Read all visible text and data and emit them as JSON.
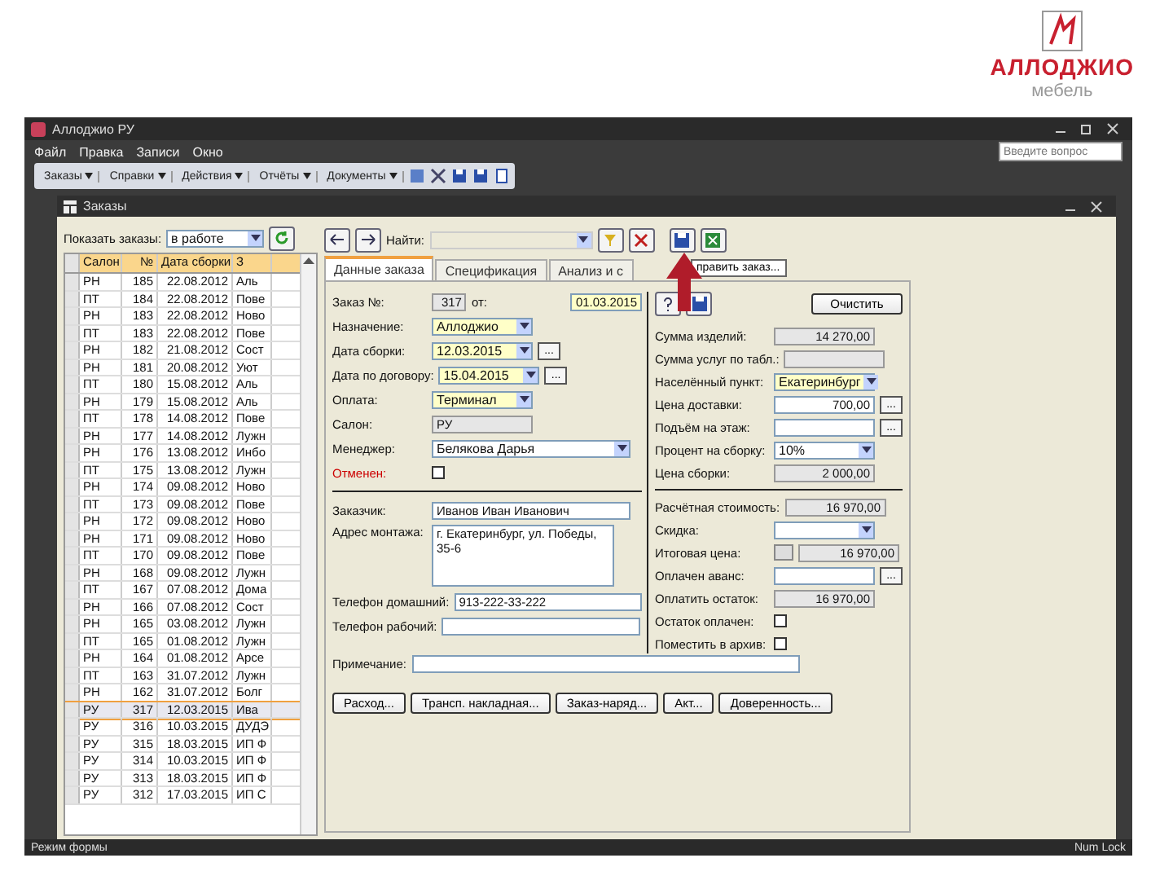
{
  "logo": {
    "brand": "АЛЛОДЖИО",
    "tagline": "мебель"
  },
  "window": {
    "title": "Аллоджио РУ"
  },
  "menu": [
    "Файл",
    "Правка",
    "Записи",
    "Окно"
  ],
  "help_box": {
    "placeholder": "Введите вопрос"
  },
  "toolbar": [
    "Заказы",
    "Справки",
    "Действия",
    "Отчёты",
    "Документы"
  ],
  "form": {
    "title": "Заказы"
  },
  "filter": {
    "label": "Показать заказы:",
    "value": "в работе"
  },
  "table": {
    "columns": [
      "Салон",
      "№",
      "Дата сборки",
      "З"
    ],
    "rows": [
      {
        "cells": [
          "РН",
          "185",
          "22.08.2012",
          "Аль"
        ],
        "selected": false
      },
      {
        "cells": [
          "ПТ",
          "184",
          "22.08.2012",
          "Пове"
        ],
        "selected": false
      },
      {
        "cells": [
          "РН",
          "183",
          "22.08.2012",
          "Ново"
        ],
        "selected": false
      },
      {
        "cells": [
          "ПТ",
          "183",
          "22.08.2012",
          "Пове"
        ],
        "selected": false
      },
      {
        "cells": [
          "РН",
          "182",
          "21.08.2012",
          "Сост"
        ],
        "selected": false
      },
      {
        "cells": [
          "РН",
          "181",
          "20.08.2012",
          "Уют"
        ],
        "selected": false
      },
      {
        "cells": [
          "ПТ",
          "180",
          "15.08.2012",
          "Аль"
        ],
        "selected": false
      },
      {
        "cells": [
          "РН",
          "179",
          "15.08.2012",
          "Аль"
        ],
        "selected": false
      },
      {
        "cells": [
          "ПТ",
          "178",
          "14.08.2012",
          "Пове"
        ],
        "selected": false
      },
      {
        "cells": [
          "РН",
          "177",
          "14.08.2012",
          "Лужн"
        ],
        "selected": false
      },
      {
        "cells": [
          "РН",
          "176",
          "13.08.2012",
          "Инбо"
        ],
        "selected": false
      },
      {
        "cells": [
          "ПТ",
          "175",
          "13.08.2012",
          "Лужн"
        ],
        "selected": false
      },
      {
        "cells": [
          "РН",
          "174",
          "09.08.2012",
          "Ново"
        ],
        "selected": false
      },
      {
        "cells": [
          "ПТ",
          "173",
          "09.08.2012",
          "Пове"
        ],
        "selected": false
      },
      {
        "cells": [
          "РН",
          "172",
          "09.08.2012",
          "Ново"
        ],
        "selected": false
      },
      {
        "cells": [
          "РН",
          "171",
          "09.08.2012",
          "Ново"
        ],
        "selected": false
      },
      {
        "cells": [
          "ПТ",
          "170",
          "09.08.2012",
          "Пове"
        ],
        "selected": false
      },
      {
        "cells": [
          "РН",
          "168",
          "09.08.2012",
          "Лужн"
        ],
        "selected": false
      },
      {
        "cells": [
          "ПТ",
          "167",
          "07.08.2012",
          "Дома"
        ],
        "selected": false
      },
      {
        "cells": [
          "РН",
          "166",
          "07.08.2012",
          "Сост"
        ],
        "selected": false
      },
      {
        "cells": [
          "РН",
          "165",
          "03.08.2012",
          "Лужн"
        ],
        "selected": false
      },
      {
        "cells": [
          "ПТ",
          "165",
          "01.08.2012",
          "Лужн"
        ],
        "selected": false
      },
      {
        "cells": [
          "РН",
          "164",
          "01.08.2012",
          "Арсе"
        ],
        "selected": false
      },
      {
        "cells": [
          "ПТ",
          "163",
          "31.07.2012",
          "Лужн"
        ],
        "selected": false
      },
      {
        "cells": [
          "РН",
          "162",
          "31.07.2012",
          "Болг"
        ],
        "selected": false
      },
      {
        "cells": [
          "РУ",
          "317",
          "12.03.2015",
          "Ива"
        ],
        "selected": true
      },
      {
        "cells": [
          "РУ",
          "316",
          "10.03.2015",
          "ДУДЭ"
        ],
        "selected": false
      },
      {
        "cells": [
          "РУ",
          "315",
          "18.03.2015",
          "ИП Ф"
        ],
        "selected": false
      },
      {
        "cells": [
          "РУ",
          "314",
          "10.03.2015",
          "ИП Ф"
        ],
        "selected": false
      },
      {
        "cells": [
          "РУ",
          "313",
          "18.03.2015",
          "ИП Ф"
        ],
        "selected": false
      },
      {
        "cells": [
          "РУ",
          "312",
          "17.03.2015",
          "ИП С"
        ],
        "selected": false
      }
    ]
  },
  "find": {
    "label": "Найти:"
  },
  "tabs": [
    {
      "label": "Данные заказа",
      "selected": true
    },
    {
      "label": "Спецификация",
      "selected": false
    },
    {
      "label": "Анализ и с",
      "selected": false
    }
  ],
  "send_button": "править заказ...",
  "clear_button": "Очистить",
  "left_fields": [
    {
      "kind": "pair",
      "label": "Заказ №:",
      "value": "317",
      "sub_label": "от:",
      "sub_value": "01.03.2015"
    },
    {
      "kind": "combo",
      "label": "Назначение:",
      "value": "Аллоджио",
      "highlight": true
    },
    {
      "kind": "combo",
      "label": "Дата сборки:",
      "value": "12.03.2015",
      "highlight": true,
      "picker": "..."
    },
    {
      "kind": "combo",
      "label": "Дата по договору:",
      "value": "15.04.2015",
      "highlight": true,
      "picker": "..."
    },
    {
      "kind": "combo",
      "label": "Оплата:",
      "value": "Терминал",
      "highlight": true
    },
    {
      "kind": "input",
      "label": "Салон:",
      "value": "РУ",
      "readonly": true
    },
    {
      "kind": "combo",
      "label": "Менеджер:",
      "value": "Белякова Дарья",
      "wide": true
    },
    {
      "kind": "check",
      "label": "Отменен:",
      "checked": false,
      "alert": true
    },
    {
      "kind": "input",
      "label": "Заказчик:",
      "value": "Иванов Иван Иванович",
      "wide": true
    },
    {
      "kind": "memo",
      "label": "Адрес монтажа:",
      "value": "г. Екатеринбург, ул. Победы, 35-6"
    },
    {
      "kind": "input",
      "label": "Телефон домашний:",
      "value": "913-222-33-222",
      "wide": true
    },
    {
      "kind": "input",
      "label": "Телефон рабочий:",
      "wide": true
    },
    {
      "kind": "note",
      "label": "Примечание:"
    }
  ],
  "right_fields": [
    {
      "kind": "input",
      "label": "Сумма изделий:",
      "value": "14 270,00",
      "readonly": true
    },
    {
      "kind": "input",
      "label": "Сумма услуг по табл.:",
      "readonly": true
    },
    {
      "kind": "combo",
      "label": "Населённый пункт:",
      "value": "Екатеринбург",
      "highlight": true
    },
    {
      "kind": "input",
      "label": "Цена доставки:",
      "value": "700,00",
      "picker": "..."
    },
    {
      "kind": "input",
      "label": "Подъём на этаж:",
      "picker": "..."
    },
    {
      "kind": "combo",
      "label": "Процент на сборку:",
      "value": "10%"
    },
    {
      "kind": "input",
      "label": "Цена сборки:",
      "value": "2 000,00",
      "readonly": true
    },
    {
      "kind": "input",
      "label": "Расчётная стоимость:",
      "value": "16 970,00",
      "readonly": true
    },
    {
      "kind": "combo",
      "label": "Скидка:"
    },
    {
      "kind": "input",
      "label": "Итоговая цена:",
      "value": "16 970,00",
      "readonly": true,
      "lock_button": true
    },
    {
      "kind": "input",
      "label": "Оплачен аванс:",
      "picker": "..."
    },
    {
      "kind": "input",
      "label": "Оплатить остаток:",
      "value": "16 970,00",
      "readonly": true
    },
    {
      "kind": "check",
      "label": "Остаток оплачен:",
      "checked": false
    },
    {
      "kind": "check",
      "label": "Поместить в архив:",
      "checked": false
    }
  ],
  "bottom_buttons": [
    "Расход...",
    "Трансп. накладная...",
    "Заказ-наряд...",
    "Акт...",
    "Доверенность..."
  ],
  "status_bar": {
    "mode": "Режим формы",
    "num_lock": "Num Lock"
  }
}
